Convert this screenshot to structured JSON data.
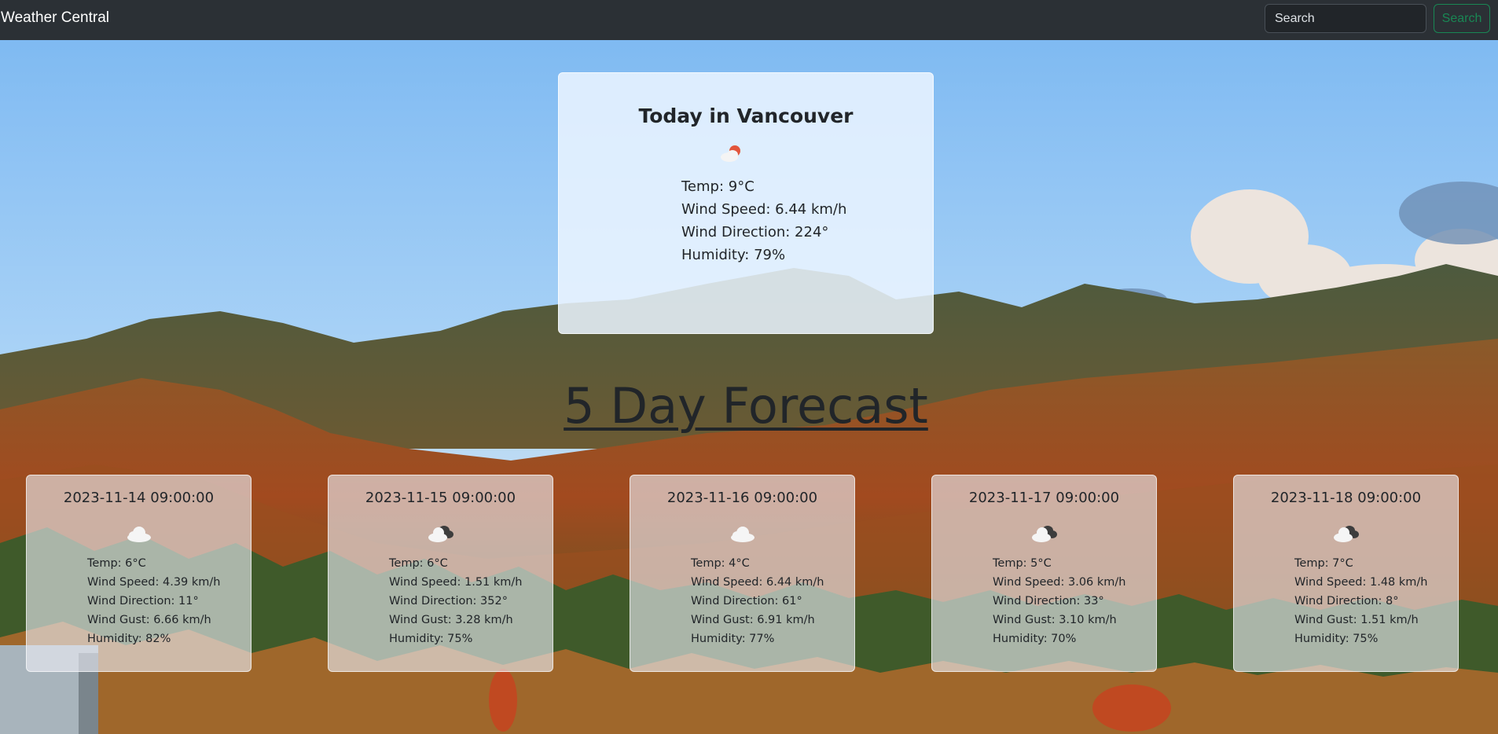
{
  "navbar": {
    "brand": "Weather Central",
    "search_placeholder": "Search",
    "search_button": "Search"
  },
  "today": {
    "title": "Today in Vancouver",
    "icon": "partly-cloudy-day-icon",
    "temp": "Temp: 9°C",
    "wind_speed": "Wind Speed: 6.44 km/h",
    "wind_direction": "Wind Direction: 224°",
    "humidity": "Humidity: 79%"
  },
  "forecast_heading": "5 Day Forecast",
  "forecast": [
    {
      "date": "2023-11-14 09:00:00",
      "icon": "cloud-icon",
      "temp": "Temp: 6°C",
      "wind_speed": "Wind Speed: 4.39 km/h",
      "wind_direction": "Wind Direction: 11°",
      "wind_gust": "Wind Gust: 6.66 km/h",
      "humidity": "Humidity: 82%"
    },
    {
      "date": "2023-11-15 09:00:00",
      "icon": "broken-clouds-icon",
      "temp": "Temp: 6°C",
      "wind_speed": "Wind Speed: 1.51 km/h",
      "wind_direction": "Wind Direction: 352°",
      "wind_gust": "Wind Gust: 3.28 km/h",
      "humidity": "Humidity: 75%"
    },
    {
      "date": "2023-11-16 09:00:00",
      "icon": "cloud-icon",
      "temp": "Temp: 4°C",
      "wind_speed": "Wind Speed: 6.44 km/h",
      "wind_direction": "Wind Direction: 61°",
      "wind_gust": "Wind Gust: 6.91 km/h",
      "humidity": "Humidity: 77%"
    },
    {
      "date": "2023-11-17 09:00:00",
      "icon": "broken-clouds-icon",
      "temp": "Temp: 5°C",
      "wind_speed": "Wind Speed: 3.06 km/h",
      "wind_direction": "Wind Direction: 33°",
      "wind_gust": "Wind Gust: 3.10 km/h",
      "humidity": "Humidity: 70%"
    },
    {
      "date": "2023-11-18 09:00:00",
      "icon": "broken-clouds-icon",
      "temp": "Temp: 7°C",
      "wind_speed": "Wind Speed: 1.48 km/h",
      "wind_direction": "Wind Direction: 8°",
      "wind_gust": "Wind Gust: 1.51 km/h",
      "humidity": "Humidity: 75%"
    }
  ]
}
